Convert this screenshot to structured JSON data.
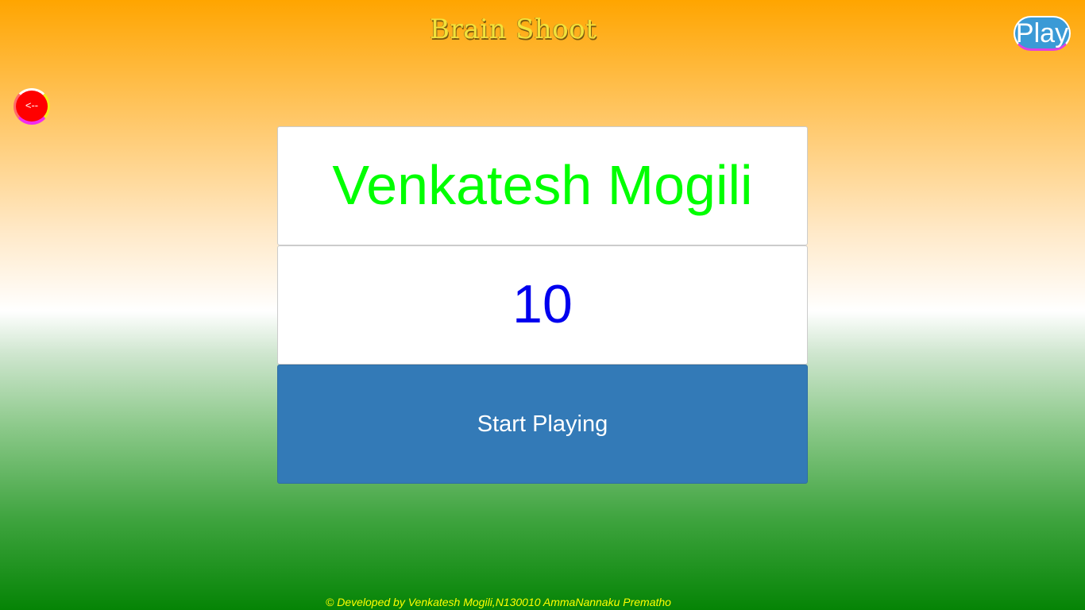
{
  "header": {
    "logo_text": "Brain Shoot",
    "play_label": "Play"
  },
  "nav": {
    "back_label": "<--"
  },
  "main": {
    "player_name": "Venkatesh Mogili",
    "score": "10",
    "start_label": "Start Playing"
  },
  "footer": {
    "credit": "© Developed by Venkatesh Mogili,N130010 AmmaNannaku Prematho"
  },
  "colors": {
    "player_name": "#00ff00",
    "score": "#0000ee",
    "start_button": "#337ab7",
    "back_button": "#ff0000",
    "play_button": "#3a9ad6",
    "footer_text": "#ffff00",
    "bg_top": "#ffa500",
    "bg_middle": "#ffffff",
    "bg_bottom": "#058405"
  }
}
